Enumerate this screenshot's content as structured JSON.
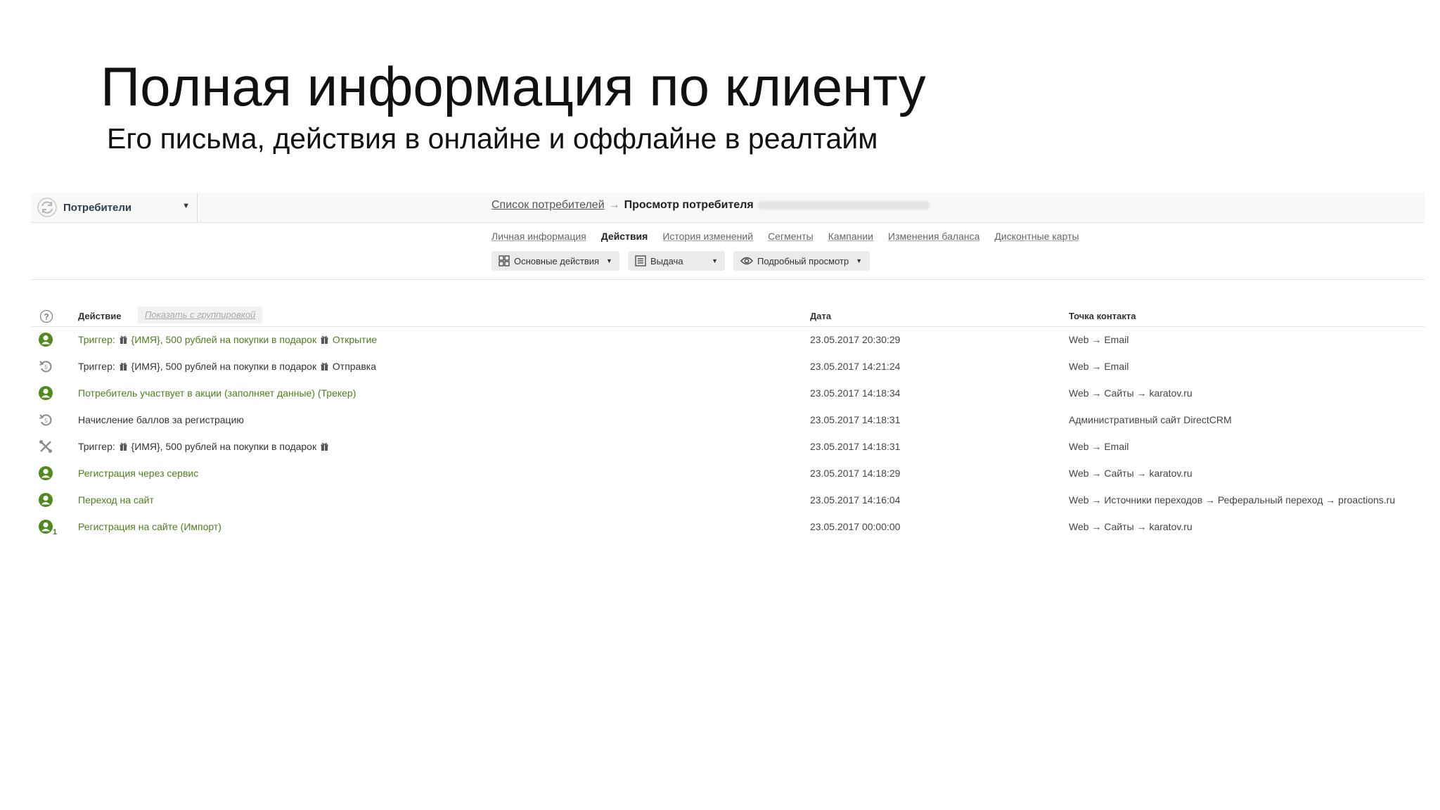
{
  "slide": {
    "title": "Полная информация по клиенту",
    "subtitle": "Его письма, действия в онлайне и оффлайне в реалтайм"
  },
  "app": {
    "module": {
      "label": "Потребители",
      "icon": "refresh-arrows-icon"
    },
    "breadcrumb": {
      "link": "Список потребителей",
      "arrow": "→",
      "current": "Просмотр потребителя"
    },
    "tabs": [
      {
        "label": "Личная информация",
        "active": false
      },
      {
        "label": "Действия",
        "active": true
      },
      {
        "label": "История изменений",
        "active": false
      },
      {
        "label": "Сегменты",
        "active": false
      },
      {
        "label": "Кампании",
        "active": false
      },
      {
        "label": "Изменения баланса",
        "active": false
      },
      {
        "label": "Дисконтные карты",
        "active": false
      }
    ],
    "toolbar": {
      "main_actions": "Основные действия",
      "output": "Выдача",
      "detailed_view": "Подробный просмотр"
    },
    "table": {
      "headers": {
        "action": "Действие",
        "grouping": "Показать с группировкой",
        "date": "Дата",
        "contact": "Точка контакта"
      },
      "rows": [
        {
          "icon": "user-green-icon",
          "color": "#4f7d1e",
          "parts": [
            "Триггер: ",
            "gift",
            " {ИМЯ}, 500 рублей на покупки в подарок ",
            "gift",
            " Открытие"
          ],
          "date": "23.05.2017 20:30:29",
          "contact": "Web → Email"
        },
        {
          "icon": "undo-gray-icon",
          "color": "#333333",
          "parts": [
            "Триггер: ",
            "gift",
            " {ИМЯ}, 500 рублей на покупки в подарок ",
            "gift",
            " Отправка"
          ],
          "date": "23.05.2017 14:21:24",
          "contact": "Web → Email"
        },
        {
          "icon": "user-green-icon",
          "color": "#4f7d1e",
          "parts": [
            "Потребитель участвует в акции (заполняет данные) (Трекер)"
          ],
          "date": "23.05.2017 14:18:34",
          "contact": "Web → Сайты → karatov.ru"
        },
        {
          "icon": "undo-gray-icon",
          "color": "#333333",
          "parts": [
            "Начисление баллов за регистрацию"
          ],
          "date": "23.05.2017 14:18:31",
          "contact": "Административный сайт DirectCRM"
        },
        {
          "icon": "tools-gray-icon",
          "color": "#333333",
          "parts": [
            "Триггер: ",
            "gift",
            " {ИМЯ}, 500 рублей на покупки в подарок ",
            "gift"
          ],
          "date": "23.05.2017 14:18:31",
          "contact": "Web → Email"
        },
        {
          "icon": "user-green-icon",
          "color": "#4f7d1e",
          "parts": [
            "Регистрация через сервис"
          ],
          "date": "23.05.2017 14:18:29",
          "contact": "Web → Сайты → karatov.ru"
        },
        {
          "icon": "user-green-icon",
          "color": "#4f7d1e",
          "parts": [
            "Переход на сайт"
          ],
          "date": "23.05.2017 14:16:04",
          "contact": "Web → Источники переходов → Реферальный переход → proactions.ru"
        },
        {
          "icon": "user-green-count-icon",
          "color": "#4f7d1e",
          "badge": "1",
          "parts": [
            "Регистрация на сайте (Импорт)"
          ],
          "date": "23.05.2017 00:00:00",
          "contact": "Web → Сайты → karatov.ru"
        }
      ]
    }
  }
}
